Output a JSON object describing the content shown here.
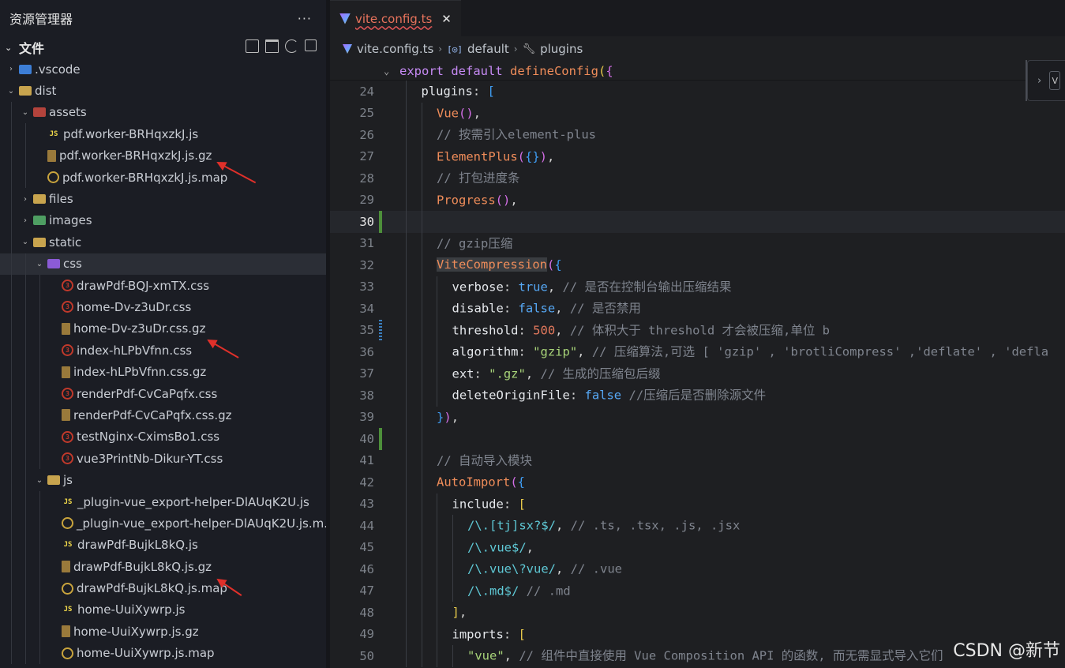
{
  "explorer": {
    "title": "资源管理器",
    "more": "···",
    "section": "文件",
    "items": [
      {
        "label": ".vscode",
        "icon": "folder-blue",
        "chev": "›",
        "depth": 0
      },
      {
        "label": "dist",
        "icon": "folder",
        "chev": "⌄",
        "depth": 0
      },
      {
        "label": "assets",
        "icon": "folder-red",
        "chev": "⌄",
        "depth": 1
      },
      {
        "label": "pdf.worker-BRHqxzkJ.js",
        "icon": "js",
        "chev": "",
        "depth": 2
      },
      {
        "label": "pdf.worker-BRHqxzkJ.js.gz",
        "icon": "gz",
        "chev": "",
        "depth": 2
      },
      {
        "label": "pdf.worker-BRHqxzkJ.js.map",
        "icon": "map",
        "chev": "",
        "depth": 2
      },
      {
        "label": "files",
        "icon": "folder",
        "chev": "›",
        "depth": 1
      },
      {
        "label": "images",
        "icon": "folder-green",
        "chev": "›",
        "depth": 1
      },
      {
        "label": "static",
        "icon": "folder",
        "chev": "⌄",
        "depth": 1
      },
      {
        "label": "css",
        "icon": "folder-purple",
        "chev": "⌄",
        "depth": 2,
        "selected": true
      },
      {
        "label": "drawPdf-BQJ-xmTX.css",
        "icon": "css",
        "chev": "",
        "depth": 3
      },
      {
        "label": "home-Dv-z3uDr.css",
        "icon": "css",
        "chev": "",
        "depth": 3
      },
      {
        "label": "home-Dv-z3uDr.css.gz",
        "icon": "gz",
        "chev": "",
        "depth": 3
      },
      {
        "label": "index-hLPbVfnn.css",
        "icon": "css",
        "chev": "",
        "depth": 3
      },
      {
        "label": "index-hLPbVfnn.css.gz",
        "icon": "gz",
        "chev": "",
        "depth": 3
      },
      {
        "label": "renderPdf-CvCaPqfx.css",
        "icon": "css",
        "chev": "",
        "depth": 3
      },
      {
        "label": "renderPdf-CvCaPqfx.css.gz",
        "icon": "gz",
        "chev": "",
        "depth": 3
      },
      {
        "label": "testNginx-CximsBo1.css",
        "icon": "css",
        "chev": "",
        "depth": 3
      },
      {
        "label": "vue3PrintNb-Dikur-YT.css",
        "icon": "css",
        "chev": "",
        "depth": 3
      },
      {
        "label": "js",
        "icon": "folder",
        "chev": "⌄",
        "depth": 2
      },
      {
        "label": "_plugin-vue_export-helper-DlAUqK2U.js",
        "icon": "js",
        "chev": "",
        "depth": 3
      },
      {
        "label": "_plugin-vue_export-helper-DlAUqK2U.js.m...",
        "icon": "map",
        "chev": "",
        "depth": 3
      },
      {
        "label": "drawPdf-BujkL8kQ.js",
        "icon": "js",
        "chev": "",
        "depth": 3
      },
      {
        "label": "drawPdf-BujkL8kQ.js.gz",
        "icon": "gz",
        "chev": "",
        "depth": 3
      },
      {
        "label": "drawPdf-BujkL8kQ.js.map",
        "icon": "map",
        "chev": "",
        "depth": 3
      },
      {
        "label": "home-UuiXywrp.js",
        "icon": "js",
        "chev": "",
        "depth": 3
      },
      {
        "label": "home-UuiXywrp.js.gz",
        "icon": "gz",
        "chev": "",
        "depth": 3
      },
      {
        "label": "home-UuiXywrp.js.map",
        "icon": "map",
        "chev": "",
        "depth": 3
      }
    ]
  },
  "tab": {
    "label": "vite.config.ts",
    "close": "✕"
  },
  "breadcrumb": {
    "file": "vite.config.ts",
    "symbol1": "default",
    "symbol2": "plugins"
  },
  "sticky": {
    "text": "export default defineConfig({"
  },
  "peek": {
    "chev": "›",
    "box": "V"
  },
  "watermark": "CSDN @新节",
  "code_lines": [
    {
      "n": "24",
      "git": "",
      "indent": 1,
      "html": "<span class='t-prop'>plugins</span><span class='t-punc'>: </span><span class='t-br3'>[</span>"
    },
    {
      "n": "25",
      "git": "",
      "indent": 2,
      "html": "<span class='t-fn'>Vue</span><span class='t-br2'>()</span><span class='t-punc'>,</span>"
    },
    {
      "n": "26",
      "git": "",
      "indent": 2,
      "html": "<span class='t-cmt'>// 按需引入element-plus</span>"
    },
    {
      "n": "27",
      "git": "",
      "indent": 2,
      "html": "<span class='t-fn'>ElementPlus</span><span class='t-br2'>(</span><span class='t-br3'>{}</span><span class='t-br2'>)</span><span class='t-punc'>,</span>"
    },
    {
      "n": "28",
      "git": "",
      "indent": 2,
      "html": "<span class='t-cmt'>// 打包进度条</span>"
    },
    {
      "n": "29",
      "git": "",
      "indent": 2,
      "html": "<span class='t-fn'>Progress</span><span class='t-br2'>()</span><span class='t-punc'>,</span>"
    },
    {
      "n": "30",
      "git": "add",
      "indent": 2,
      "html": "",
      "current": true
    },
    {
      "n": "31",
      "git": "",
      "indent": 2,
      "html": "<span class='t-cmt'>// gzip压缩</span>"
    },
    {
      "n": "32",
      "git": "",
      "indent": 2,
      "html": "<span class='t-fn hl'>ViteCompression</span><span class='t-br2'>(</span><span class='t-br3'>{</span>"
    },
    {
      "n": "33",
      "git": "",
      "indent": 3,
      "html": "<span class='t-prop'>verbose</span><span class='t-punc'>: </span><span class='t-bool'>true</span><span class='t-punc'>, </span><span class='t-cmt'>// 是否在控制台输出压缩结果</span>"
    },
    {
      "n": "34",
      "git": "",
      "indent": 3,
      "html": "<span class='t-prop'>disable</span><span class='t-punc'>: </span><span class='t-bool'>false</span><span class='t-punc'>, </span><span class='t-cmt'>// 是否禁用</span>"
    },
    {
      "n": "35",
      "git": "mod",
      "indent": 3,
      "html": "<span class='t-prop'>threshold</span><span class='t-punc'>: </span><span class='t-num'>500</span><span class='t-punc'>, </span><span class='t-cmt'>// 体积大于 threshold 才会被压缩,单位 b</span>"
    },
    {
      "n": "36",
      "git": "",
      "indent": 3,
      "html": "<span class='t-prop'>algorithm</span><span class='t-punc'>: </span><span class='t-str'>\"gzip\"</span><span class='t-punc'>, </span><span class='t-cmt'>// 压缩算法,可选 [ 'gzip' , 'brotliCompress' ,'deflate' , 'defla</span>"
    },
    {
      "n": "37",
      "git": "",
      "indent": 3,
      "html": "<span class='t-prop'>ext</span><span class='t-punc'>: </span><span class='t-str'>\".gz\"</span><span class='t-punc'>, </span><span class='t-cmt'>// 生成的压缩包后缀</span>"
    },
    {
      "n": "38",
      "git": "",
      "indent": 3,
      "html": "<span class='t-prop'>deleteOriginFile</span><span class='t-punc'>: </span><span class='t-bool'>false</span><span class='t-punc'> </span><span class='t-cmt'>//压缩后是否删除源文件</span>"
    },
    {
      "n": "39",
      "git": "",
      "indent": 2,
      "html": "<span class='t-br3'>}</span><span class='t-br2'>)</span><span class='t-punc'>,</span>"
    },
    {
      "n": "40",
      "git": "add",
      "indent": 2,
      "html": ""
    },
    {
      "n": "41",
      "git": "",
      "indent": 2,
      "html": "<span class='t-cmt'>// 自动导入模块</span>"
    },
    {
      "n": "42",
      "git": "",
      "indent": 2,
      "html": "<span class='t-fn'>AutoImport</span><span class='t-br2'>(</span><span class='t-br3'>{</span>"
    },
    {
      "n": "43",
      "git": "",
      "indent": 3,
      "html": "<span class='t-prop'>include</span><span class='t-punc'>: </span><span class='t-br1'>[</span>"
    },
    {
      "n": "44",
      "git": "",
      "indent": 4,
      "html": "<span class='t-re'>/\\.[tj]sx?$/</span><span class='t-punc'>, </span><span class='t-cmt'>// .ts, .tsx, .js, .jsx</span>"
    },
    {
      "n": "45",
      "git": "",
      "indent": 4,
      "html": "<span class='t-re'>/\\.vue$/</span><span class='t-punc'>,</span>"
    },
    {
      "n": "46",
      "git": "",
      "indent": 4,
      "html": "<span class='t-re'>/\\.vue\\?vue/</span><span class='t-punc'>, </span><span class='t-cmt'>// .vue</span>"
    },
    {
      "n": "47",
      "git": "",
      "indent": 4,
      "html": "<span class='t-re'>/\\.md$/</span><span class='t-punc'> </span><span class='t-cmt'>// .md</span>"
    },
    {
      "n": "48",
      "git": "",
      "indent": 3,
      "html": "<span class='t-br1'>]</span><span class='t-punc'>,</span>"
    },
    {
      "n": "49",
      "git": "",
      "indent": 3,
      "html": "<span class='t-prop'>imports</span><span class='t-punc'>: </span><span class='t-br1'>[</span>"
    },
    {
      "n": "50",
      "git": "",
      "indent": 4,
      "html": "<span class='t-str'>\"vue\"</span><span class='t-punc'>, </span><span class='t-cmt'>// 组件中直接使用 Vue Composition API 的函数, 而无需显式导入它们</span>"
    }
  ]
}
